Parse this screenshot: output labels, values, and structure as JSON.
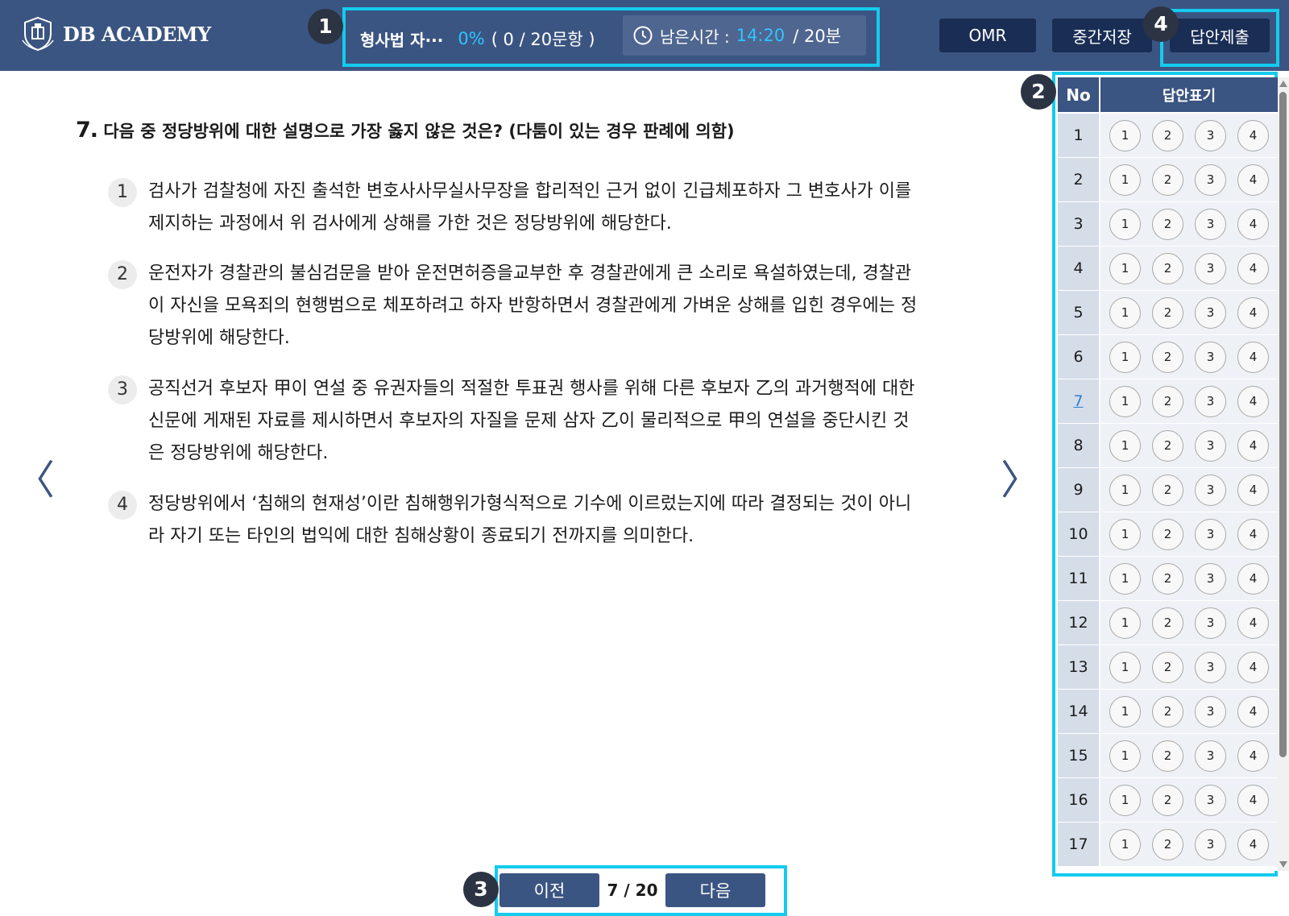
{
  "header": {
    "logo_text": "DB ACADEMY",
    "exam_title": "형사법 자···",
    "progress_percent": "0%",
    "progress_count": "( 0 / 20문항 )",
    "timer_label": "남은시간 :",
    "timer_remaining": "14:20",
    "timer_total": "/ 20분",
    "omr_button": "OMR",
    "save_button": "중간저장",
    "submit_button": "답안제출"
  },
  "callouts": [
    "1",
    "2",
    "3",
    "4"
  ],
  "question": {
    "number": "7.",
    "text": "다음 중 정당방위에 대한 설명으로 가장 옳지 않은 것은? (다툼이 있는 경우 판례에 의함)",
    "choices": [
      {
        "num": "1",
        "text": "검사가 검찰청에 자진 출석한 변호사사무실사무장을 합리적인 근거 없이 긴급체포하자 그 변호사가 이를 제지하는 과정에서 위 검사에게 상해를 가한 것은 정당방위에 해당한다."
      },
      {
        "num": "2",
        "text": "운전자가 경찰관의 불심검문을 받아 운전면허증을교부한 후 경찰관에게 큰 소리로 욕설하였는데, 경찰관이 자신을 모욕죄의 현행범으로 체포하려고 하자 반항하면서 경찰관에게 가벼운 상해를 입힌 경우에는 정당방위에 해당한다."
      },
      {
        "num": "3",
        "text": "공직선거 후보자 甲이 연설 중 유권자들의 적절한 투표권 행사를 위해 다른 후보자 乙의 과거행적에 대한 신문에 게재된 자료를 제시하면서 후보자의 자질을 문제 삼자 乙이 물리적으로 甲의 연설을 중단시킨 것은 정당방위에 해당한다."
      },
      {
        "num": "4",
        "text": "정당방위에서 ‘침해의 현재성’이란 침해행위가형식적으로 기수에 이르렀는지에 따라 결정되는 것이 아니라 자기 또는 타인의 법익에 대한 침해상황이 종료되기 전까지를 의미한다."
      }
    ]
  },
  "nav": {
    "prev_arrow": "〈",
    "next_arrow": "〉"
  },
  "pager": {
    "prev": "이전",
    "indicator": "7 / 20",
    "next": "다음"
  },
  "answer_sheet": {
    "col_no": "No",
    "col_mark": "답안표기",
    "current": "7",
    "options": [
      "1",
      "2",
      "3",
      "4"
    ],
    "rows": [
      "1",
      "2",
      "3",
      "4",
      "5",
      "6",
      "7",
      "8",
      "9",
      "10",
      "11",
      "12",
      "13",
      "14",
      "15",
      "16",
      "17"
    ]
  },
  "colors": {
    "header_bg": "#3b5582",
    "accent": "#2fc4ff",
    "callout": "#14cbee",
    "button_dark": "#1a2e55"
  }
}
